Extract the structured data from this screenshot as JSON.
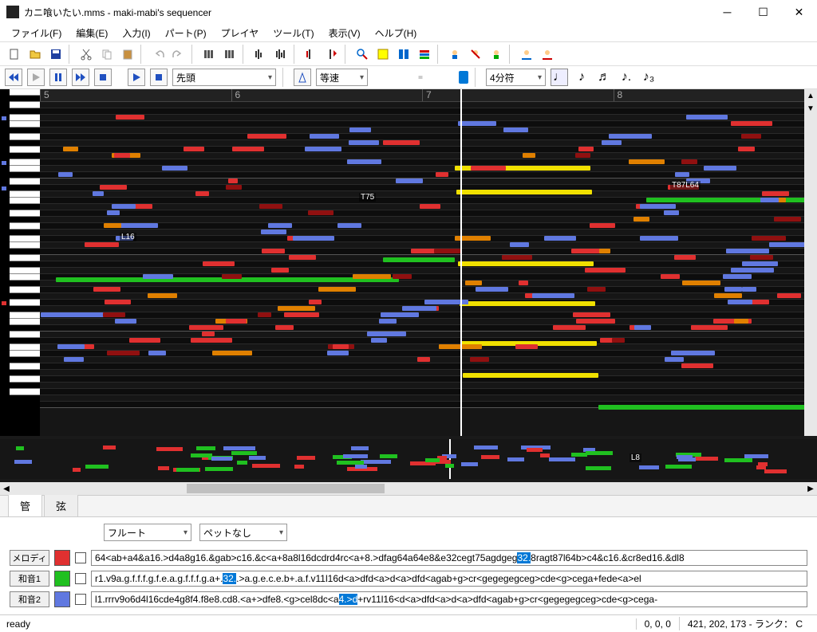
{
  "window": {
    "title": "カニ喰いたい.mms - maki-mabi's sequencer"
  },
  "menu": {
    "file": "ファイル(F)",
    "edit": "編集(E)",
    "input": "入力(I)",
    "part": "パート(P)",
    "player": "プレイヤ",
    "tool": "ツール(T)",
    "view": "表示(V)",
    "help": "ヘルプ(H)"
  },
  "transport": {
    "pos_combo": "先頭",
    "speed_combo": "等速",
    "note_combo": "4分符"
  },
  "ruler": {
    "bars": [
      "5",
      "6",
      "7",
      "8"
    ]
  },
  "markers": {
    "l16": "L16",
    "t75": "T75",
    "t87": "T87L64",
    "l8": "L8"
  },
  "tabs": {
    "wind": "管",
    "string": "弦"
  },
  "inst": {
    "sel1": "フルート",
    "sel2": "ペットなし"
  },
  "mml": {
    "melody_label": "メロディ",
    "melody_text_a": "64<ab+a4&a16.>d4a8g16.&gab>c16.&c<a+8a8l16dcdrd4rc<a+8.>dfag64a64e8&e32cegt75agdgeg",
    "melody_sel": "32.",
    "melody_text_b": "8ragt87l64b>c4&c16.&cr8ed16.&dl8",
    "chord1_label": "和音1",
    "chord1_text_a": "r1.v9a.g.f.f.f.g.f.e.a.g.f.f.f.g.a+.",
    "chord1_sel": "32.",
    "chord1_text_b": ".>a.g.e.c.e.b+.a.f.v11l16d<a>dfd<a>d<a>dfd<agab+g>cr<gegegegceg>cde<g>cega+fede<a>el",
    "chord2_label": "和音2",
    "chord2_text_a": "l1.rrrv9o6d4l16cde4g8f4.f8e8.cd8.<a+>dfe8.<g>cel8dc<a",
    "chord2_sel": "4.>d",
    "chord2_text_b": "+rv11l16<d<a>dfd<a>d<a>dfd<agab+g>cr<gegegegceg>cde<g>cega-",
    "colors": {
      "melody": "#e03030",
      "chord1": "#20c020",
      "chord2": "#6078e0"
    }
  },
  "status": {
    "ready": "ready",
    "pos": "0, 0, 0",
    "info": "421, 202, 173 - ランク： C"
  }
}
